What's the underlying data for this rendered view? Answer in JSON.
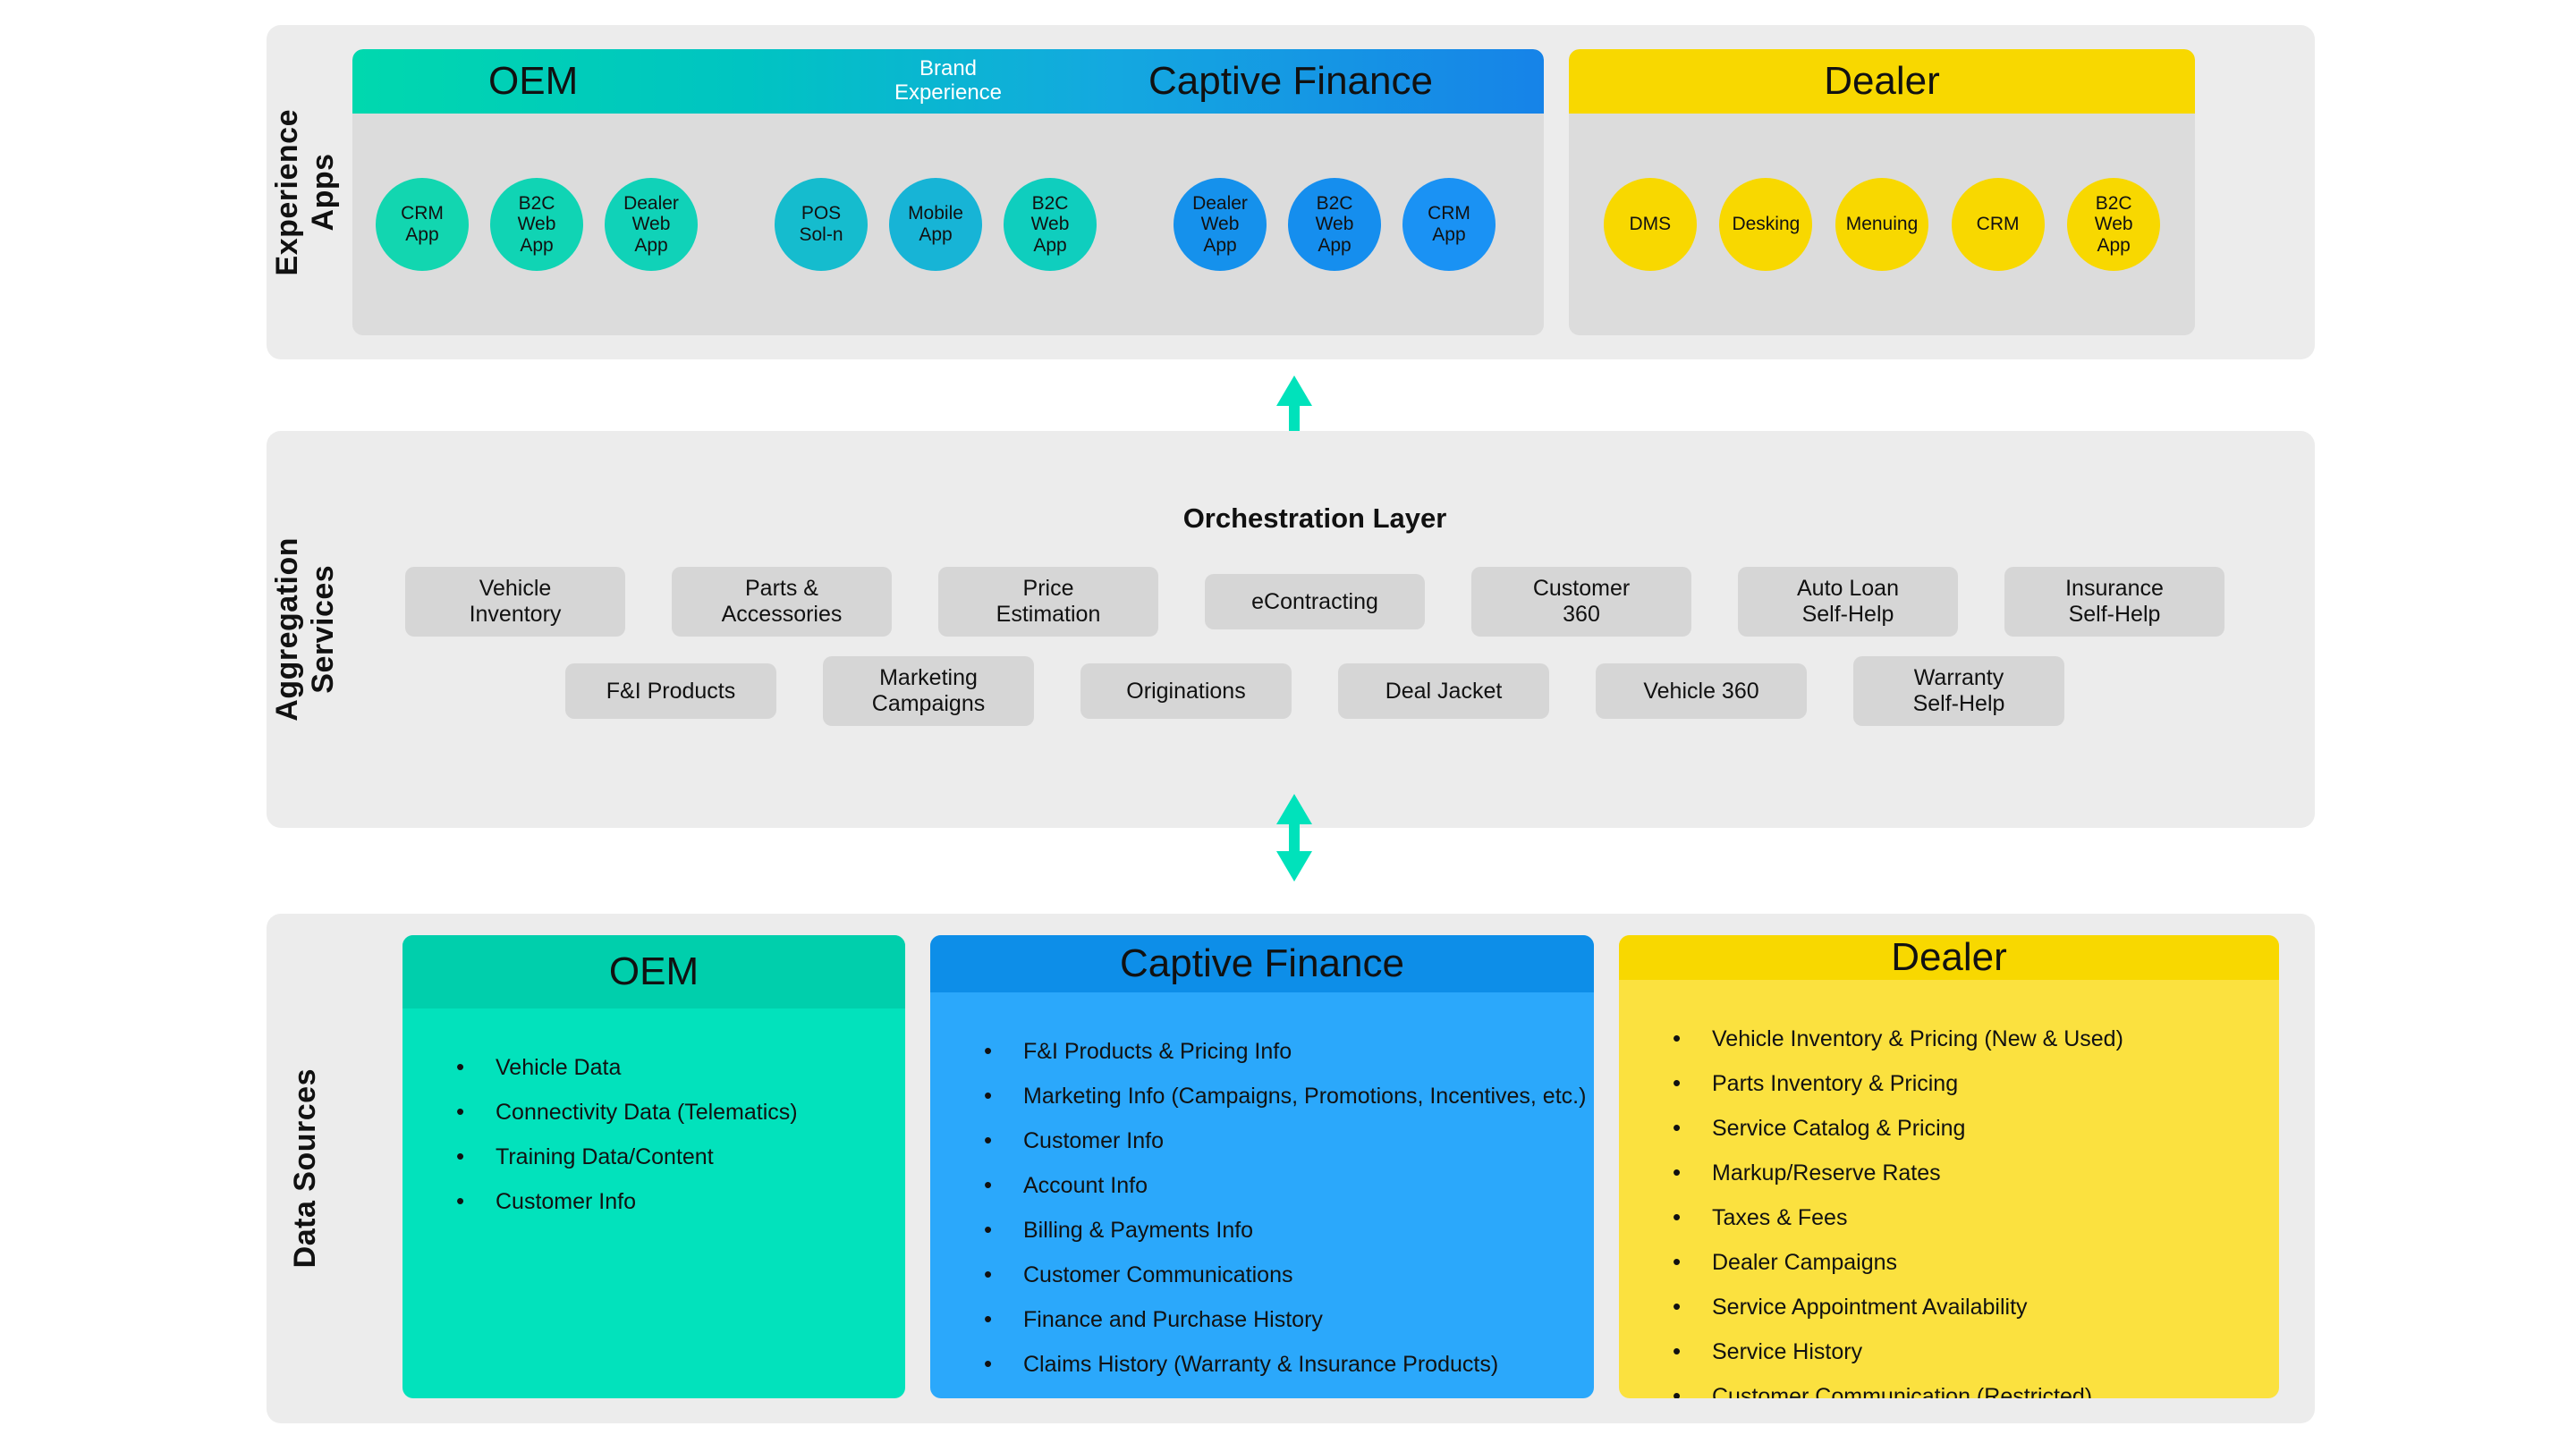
{
  "bands": {
    "experience": {
      "label": "Experience\nApps",
      "groups": [
        {
          "id": "brand-experience",
          "header_left": "OEM",
          "header_center": "Brand\nExperience",
          "header_right": "Captive Finance",
          "circles": [
            {
              "label": "CRM\nApp",
              "color": "#12D6B0"
            },
            {
              "label": "B2C\nWeb\nApp",
              "color": "#10D4B4"
            },
            {
              "label": "Dealer\nWeb\nApp",
              "color": "#10D2B8"
            },
            {
              "label": "POS\nSol-n",
              "color": "#15BCCE"
            },
            {
              "label": "Mobile\nApp",
              "color": "#17B4D6"
            },
            {
              "label": "B2C\nWeb\nApp",
              "color": "#0FCEBE"
            },
            {
              "label": "Dealer\nWeb\nApp",
              "color": "#1591EC"
            },
            {
              "label": "B2C\nWeb\nApp",
              "color": "#158EEE"
            },
            {
              "label": "CRM\nApp",
              "color": "#1A92F4"
            }
          ]
        },
        {
          "id": "dealer",
          "header_single": "Dealer",
          "circles": [
            {
              "label": "DMS",
              "color": "#F8D800"
            },
            {
              "label": "Desking",
              "color": "#F8D800"
            },
            {
              "label": "Menuing",
              "color": "#F8D800"
            },
            {
              "label": "CRM",
              "color": "#F8D800"
            },
            {
              "label": "B2C\nWeb\nApp",
              "color": "#F8D800"
            }
          ]
        }
      ]
    },
    "aggregation": {
      "label": "Aggregation\nServices",
      "title": "Orchestration Layer",
      "row1": [
        "Vehicle\nInventory",
        "Parts &\nAccessories",
        "Price\nEstimation",
        "eContracting",
        "Customer\n360",
        "Auto Loan\nSelf-Help",
        "Insurance\nSelf-Help"
      ],
      "row2": [
        "F&I Products",
        "Marketing\nCampaigns",
        "Originations",
        "Deal Jacket",
        "Vehicle 360",
        "Warranty\nSelf-Help"
      ]
    },
    "datasources": {
      "label": "Data Sources",
      "cards": [
        {
          "id": "oem",
          "title": "OEM",
          "items": [
            "Vehicle Data",
            "Connectivity Data (Telematics)",
            "Training Data/Content",
            "Customer Info"
          ]
        },
        {
          "id": "captive-finance",
          "title": "Captive Finance",
          "items": [
            "F&I Products & Pricing Info",
            "Marketing Info (Campaigns, Promotions, Incentives, etc.)",
            "Customer Info",
            "Account Info",
            "Billing & Payments Info",
            "Customer Communications",
            "Finance and Purchase History",
            "Claims History (Warranty & Insurance Products)"
          ]
        },
        {
          "id": "dealer",
          "title": "Dealer",
          "items": [
            "Vehicle Inventory & Pricing (New & Used)",
            "Parts Inventory & Pricing",
            "Service Catalog & Pricing",
            "Markup/Reserve Rates",
            "Taxes & Fees",
            "Dealer Campaigns",
            "Service Appointment Availability",
            "Service History",
            "Customer Communication (Restricted)"
          ]
        }
      ]
    }
  },
  "colors": {
    "background": "#FFFFFF",
    "band_background": "#ECECEC",
    "group_card_background": "#DCDCDC",
    "service_chip": "#D6D6D6",
    "gradient_start": "#00D8AE",
    "gradient_end": "#1683E8",
    "yellow": "#F8D800",
    "teal": "#02E2BC",
    "blue": "#2BA8FB",
    "connector_arrow": "#00E2BB",
    "text": "#111111"
  }
}
